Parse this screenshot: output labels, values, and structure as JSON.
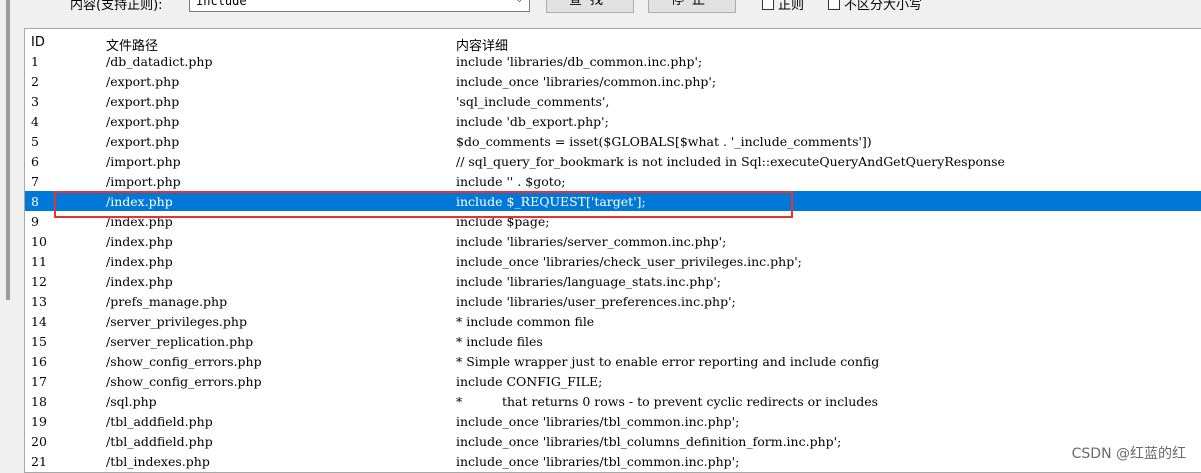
{
  "toolbar": {
    "search_label": "内容(支持正则):",
    "search_value": "include",
    "find_label": "查找",
    "stop_label": "停止",
    "regex_label": "正则",
    "case_label": "不区分大小写"
  },
  "table": {
    "columns": [
      "ID",
      "文件路径",
      "内容详细"
    ],
    "selected_id": "8",
    "rows": [
      {
        "id": "1",
        "path": "/db_datadict.php",
        "detail": "include 'libraries/db_common.inc.php';"
      },
      {
        "id": "2",
        "path": "/export.php",
        "detail": "include_once 'libraries/common.inc.php';"
      },
      {
        "id": "3",
        "path": "/export.php",
        "detail": "'sql_include_comments',"
      },
      {
        "id": "4",
        "path": "/export.php",
        "detail": "include 'db_export.php';"
      },
      {
        "id": "5",
        "path": "/export.php",
        "detail": "$do_comments = isset($GLOBALS[$what . '_include_comments'])"
      },
      {
        "id": "6",
        "path": "/import.php",
        "detail": "// sql_query_for_bookmark is not included in Sql::executeQueryAndGetQueryResponse"
      },
      {
        "id": "7",
        "path": "/import.php",
        "detail": "include '' . $goto;"
      },
      {
        "id": "8",
        "path": "/index.php",
        "detail": "include $_REQUEST['target'];"
      },
      {
        "id": "9",
        "path": "/index.php",
        "detail": "include $page;"
      },
      {
        "id": "10",
        "path": "/index.php",
        "detail": "include 'libraries/server_common.inc.php';"
      },
      {
        "id": "11",
        "path": "/index.php",
        "detail": "include_once 'libraries/check_user_privileges.inc.php';"
      },
      {
        "id": "12",
        "path": "/index.php",
        "detail": "include 'libraries/language_stats.inc.php';"
      },
      {
        "id": "13",
        "path": "/prefs_manage.php",
        "detail": "include 'libraries/user_preferences.inc.php';"
      },
      {
        "id": "14",
        "path": "/server_privileges.php",
        "detail": "* include common file"
      },
      {
        "id": "15",
        "path": "/server_replication.php",
        "detail": "* include files"
      },
      {
        "id": "16",
        "path": "/show_config_errors.php",
        "detail": "* Simple wrapper just to enable error reporting and include config"
      },
      {
        "id": "17",
        "path": "/show_config_errors.php",
        "detail": "include CONFIG_FILE;"
      },
      {
        "id": "18",
        "path": "/sql.php",
        "detail": "*          that returns 0 rows - to prevent cyclic redirects or includes"
      },
      {
        "id": "19",
        "path": "/tbl_addfield.php",
        "detail": "include_once 'libraries/tbl_common.inc.php';"
      },
      {
        "id": "20",
        "path": "/tbl_addfield.php",
        "detail": "include_once 'libraries/tbl_columns_definition_form.inc.php';"
      },
      {
        "id": "21",
        "path": "/tbl_indexes.php",
        "detail": "include_once 'libraries/tbl_common.inc.php';"
      }
    ]
  },
  "watermark": "CSDN @红蓝的红",
  "colors": {
    "selection": "#0078d7",
    "annotation_border": "#e53333"
  }
}
